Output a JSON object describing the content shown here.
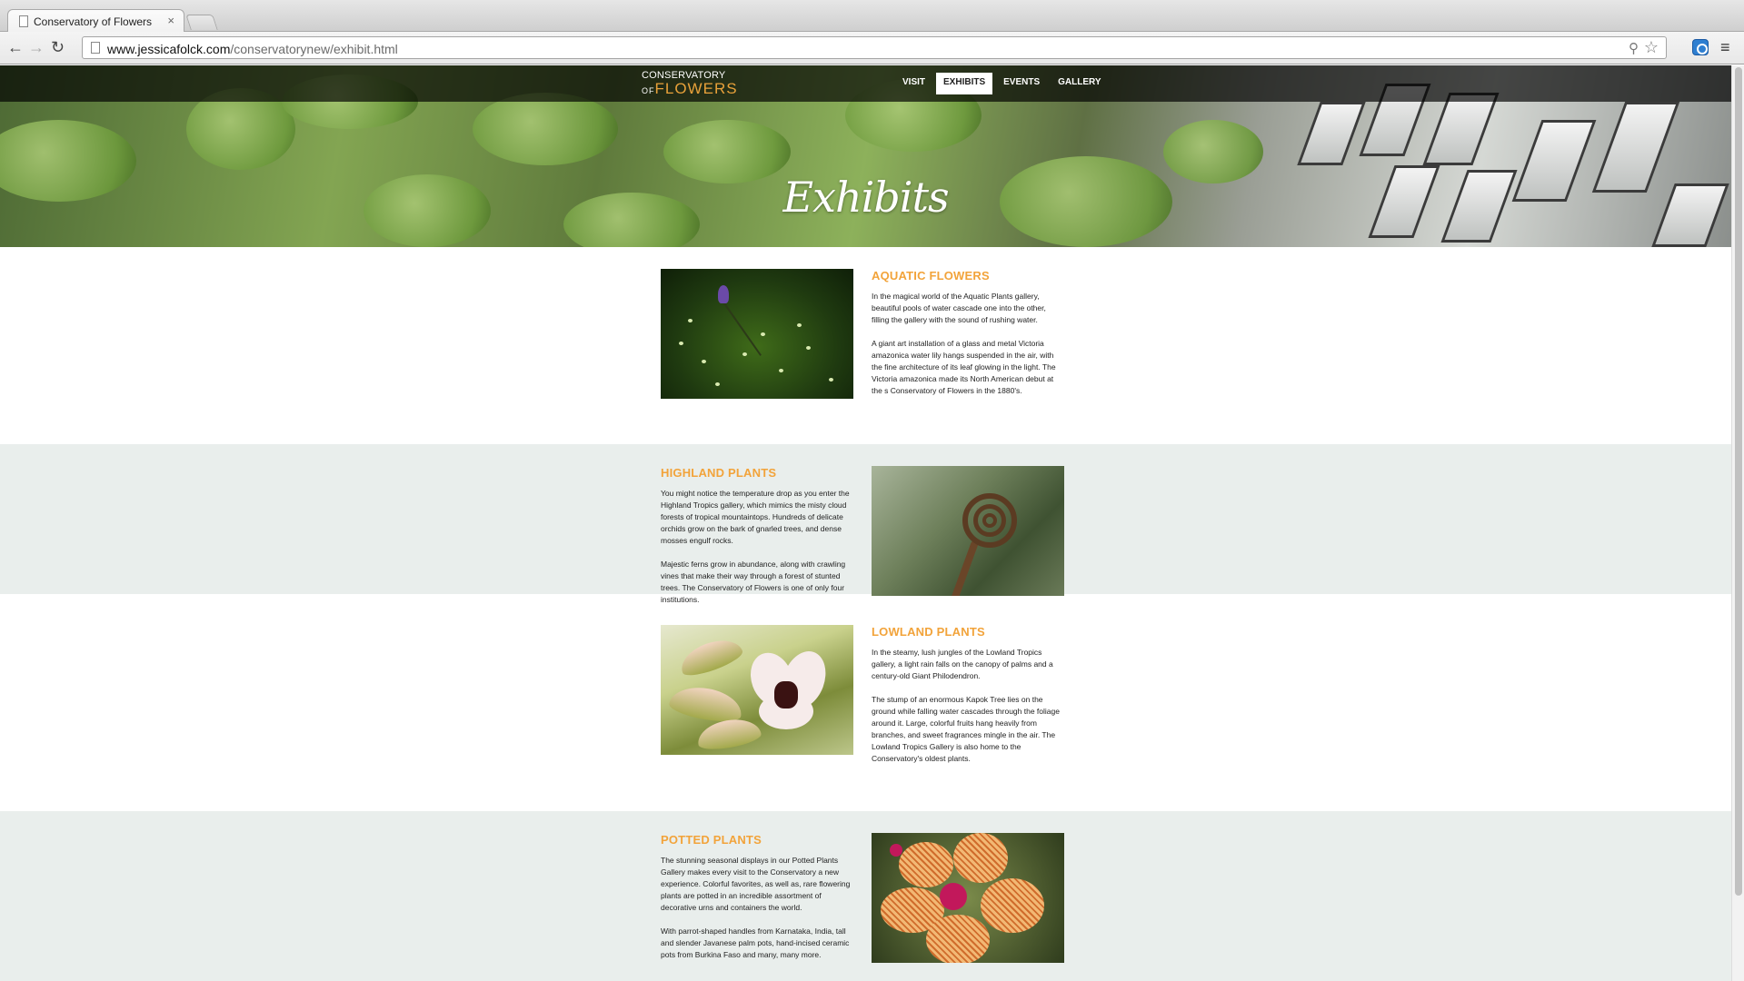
{
  "browser": {
    "tab_title": "Conservatory of Flowers",
    "tab_close": "×",
    "url_domain": "www.jessicafolck.com",
    "url_path": "/conservatorynew/exhibit.html",
    "back_glyph": "←",
    "forward_glyph": "→",
    "reload_glyph": "↻",
    "zoom_glyph": "⚲",
    "star_glyph": "☆",
    "menu_glyph": "≡"
  },
  "site": {
    "logo_top": "CONSERVATORY",
    "logo_of": "OF",
    "logo_bottom": "FLOWERS",
    "nav": [
      {
        "label": "VISIT",
        "active": false
      },
      {
        "label": "EXHIBITS",
        "active": true
      },
      {
        "label": "EVENTS",
        "active": false
      },
      {
        "label": "GALLERY",
        "active": false
      }
    ],
    "hero_title": "Exhibits"
  },
  "exhibits": [
    {
      "title": "AQUATIC FLOWERS",
      "paragraphs": [
        "In the magical world of the Aquatic Plants gallery, beautiful pools of water cascade one into the other, filling the gallery with the sound of rushing water.",
        "A giant art installation of a glass and metal Victoria amazonica water lily hangs suspended in the air, with the fine architecture of its leaf glowing in the light. The Victoria amazonica made its North American debut at the s Conservatory of Flowers in the 1880's."
      ]
    },
    {
      "title": "HIGHLAND PLANTS",
      "paragraphs": [
        "You might notice the temperature drop as you enter the Highland Tropics gallery, which mimics the misty cloud forests of tropical mountaintops. Hundreds of delicate orchids grow on the bark of gnarled trees, and dense mosses engulf rocks.",
        "Majestic ferns grow in abundance, along with crawling vines that make their way through a forest of stunted trees. The Conservatory of Flowers is one of only four institutions."
      ]
    },
    {
      "title": "LOWLAND PLANTS",
      "paragraphs": [
        "In the steamy, lush jungles of the Lowland Tropics gallery, a light rain falls on the canopy of palms and a century-old Giant Philodendron.",
        "The stump of an enormous Kapok Tree lies on the ground while falling water cascades through the foliage around it. Large, colorful fruits hang heavily from branches, and sweet fragrances mingle in the air. The Lowland Tropics Gallery is also home to the Conservatory's oldest plants."
      ]
    },
    {
      "title": "POTTED PLANTS",
      "paragraphs": [
        "The stunning seasonal displays in our Potted Plants Gallery makes every visit to the Conservatory a new experience. Colorful favorites, as well as, rare flowering plants are potted in an incredible assortment of decorative urns and containers the world.",
        "With parrot-shaped handles from Karnataka, India, tall and slender Javanese palm pots, hand-incised ceramic pots from Burkina Faso and many, many more."
      ]
    }
  ],
  "colors": {
    "accent": "#f2a33a",
    "alt_band": "#e9eeec",
    "nav_bar": "#1e1e1e"
  }
}
